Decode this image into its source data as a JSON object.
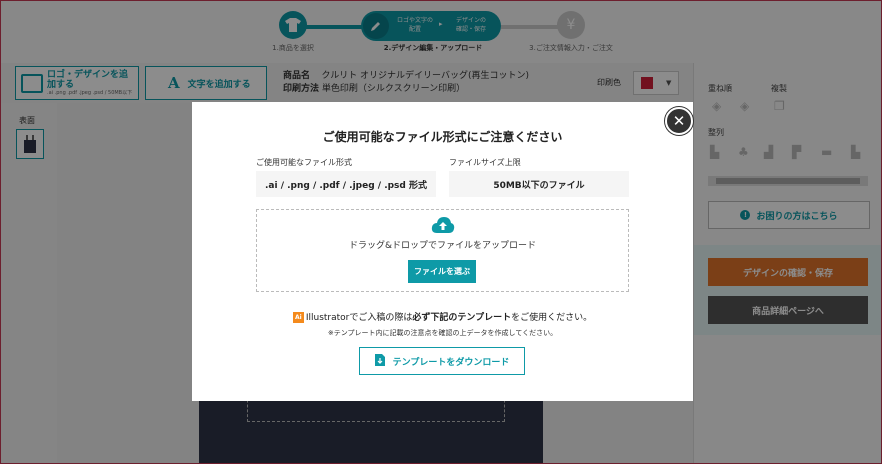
{
  "stepper": {
    "step1_label": "1.商品を選択",
    "step2_pill_line1": "ロゴや文字の",
    "step2_pill_line2": "配置",
    "step2_pill_line3": "デザインの",
    "step2_pill_line4": "確認・保存",
    "step2_label": "2.デザイン編集・アップロード",
    "step3_label": "3.ご注文情報入力・ご注文",
    "step3_icon": "¥"
  },
  "toolbar": {
    "add_logo_label": "ロゴ・デザインを追加する",
    "add_logo_sub": ".ai .png .pdf .jpeg .psd / 50MB以下",
    "add_text_label": "文字を追加する",
    "product_name_label": "商品名",
    "product_name": "クルリト オリジナルデイリーバッグ(再生コットン)",
    "print_method_label": "印刷方法",
    "print_method": "単色印刷（シルクスクリーン印刷）",
    "print_color_label": "印刷色",
    "print_color": "#d0203a"
  },
  "left": {
    "side_label": "表面"
  },
  "right": {
    "layer_order": "重ね順",
    "duplicate": "複製",
    "align": "整列",
    "help": "お困りの方はこちら",
    "confirm_save": "デザインの確認・保存",
    "product_detail": "商品詳細ページへ"
  },
  "modal": {
    "title": "ご使用可能なファイル形式にご注意ください",
    "formats_label": "ご使用可能なファイル形式",
    "formats_value": ".ai / .png / .pdf / .jpeg / .psd 形式",
    "size_label": "ファイルサイズ上限",
    "size_value": "50MB以下のファイル",
    "drop_text": "ドラッグ&ドロップでファイルをアップロード",
    "choose_file": "ファイルを選ぶ",
    "ai_badge": "Ai",
    "ai_pre": "Illustratorでご入稿の際は",
    "ai_bold": "必ず下記のテンプレート",
    "ai_post": "をご使用ください。",
    "note": "※テンプレート内に記載の注意点を確認の上データを作成してください。",
    "download_template": "テンプレートをダウンロード"
  }
}
